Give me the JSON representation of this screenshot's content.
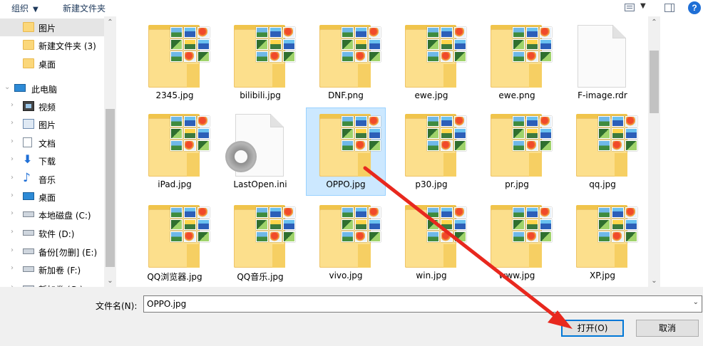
{
  "toolbar": {
    "organize_label": "组织",
    "new_folder_label": "新建文件夹",
    "help_glyph": "?"
  },
  "nav": {
    "items": [
      {
        "label": "图片",
        "icon": "folder-icon",
        "selected": true
      },
      {
        "label": "新建文件夹 (3)",
        "icon": "folder-icon"
      },
      {
        "label": "桌面",
        "icon": "folder-icon"
      },
      {
        "label": "此电脑",
        "icon": "computer-icon"
      },
      {
        "label": "视频",
        "icon": "video-icon"
      },
      {
        "label": "图片",
        "icon": "pictures-icon"
      },
      {
        "label": "文档",
        "icon": "document-icon"
      },
      {
        "label": "下载",
        "icon": "download-icon"
      },
      {
        "label": "音乐",
        "icon": "music-icon"
      },
      {
        "label": "桌面",
        "icon": "desktop-icon"
      },
      {
        "label": "本地磁盘 (C:)",
        "icon": "drive-icon"
      },
      {
        "label": "软件 (D:)",
        "icon": "drive-icon"
      },
      {
        "label": "备份[勿删] (E:)",
        "icon": "drive-icon"
      },
      {
        "label": "新加卷 (F:)",
        "icon": "drive-icon"
      },
      {
        "label": "新加卷 (G:)",
        "icon": "drive-icon"
      }
    ]
  },
  "files": [
    {
      "name": "2345.jpg",
      "kind": "image-folder"
    },
    {
      "name": "bilibili.jpg",
      "kind": "image-folder"
    },
    {
      "name": "DNF.png",
      "kind": "image-folder"
    },
    {
      "name": "ewe.jpg",
      "kind": "image-folder"
    },
    {
      "name": "ewe.png",
      "kind": "image-folder"
    },
    {
      "name": "F-image.rdr",
      "kind": "document"
    },
    {
      "name": "iPad.jpg",
      "kind": "image-folder"
    },
    {
      "name": "LastOpen.ini",
      "kind": "settings"
    },
    {
      "name": "OPPO.jpg",
      "kind": "image-folder",
      "selected": true
    },
    {
      "name": "p30.jpg",
      "kind": "image-folder"
    },
    {
      "name": "pr.jpg",
      "kind": "image-folder"
    },
    {
      "name": "qq.jpg",
      "kind": "image-folder"
    },
    {
      "name": "QQ浏览器.jpg",
      "kind": "image-folder"
    },
    {
      "name": "QQ音乐.jpg",
      "kind": "image-folder"
    },
    {
      "name": "vivo.jpg",
      "kind": "image-folder"
    },
    {
      "name": "win.jpg",
      "kind": "image-folder"
    },
    {
      "name": "www.jpg",
      "kind": "image-folder"
    },
    {
      "name": "XP.jpg",
      "kind": "image-folder"
    }
  ],
  "bottom": {
    "filename_label": "文件名(N):",
    "filename_value": "OPPO.jpg",
    "open_label": "打开(O)",
    "cancel_label": "取消"
  },
  "colors": {
    "accent": "#0078d7",
    "selection_fill": "#cce8ff",
    "annotation_arrow": "#e8281e"
  }
}
